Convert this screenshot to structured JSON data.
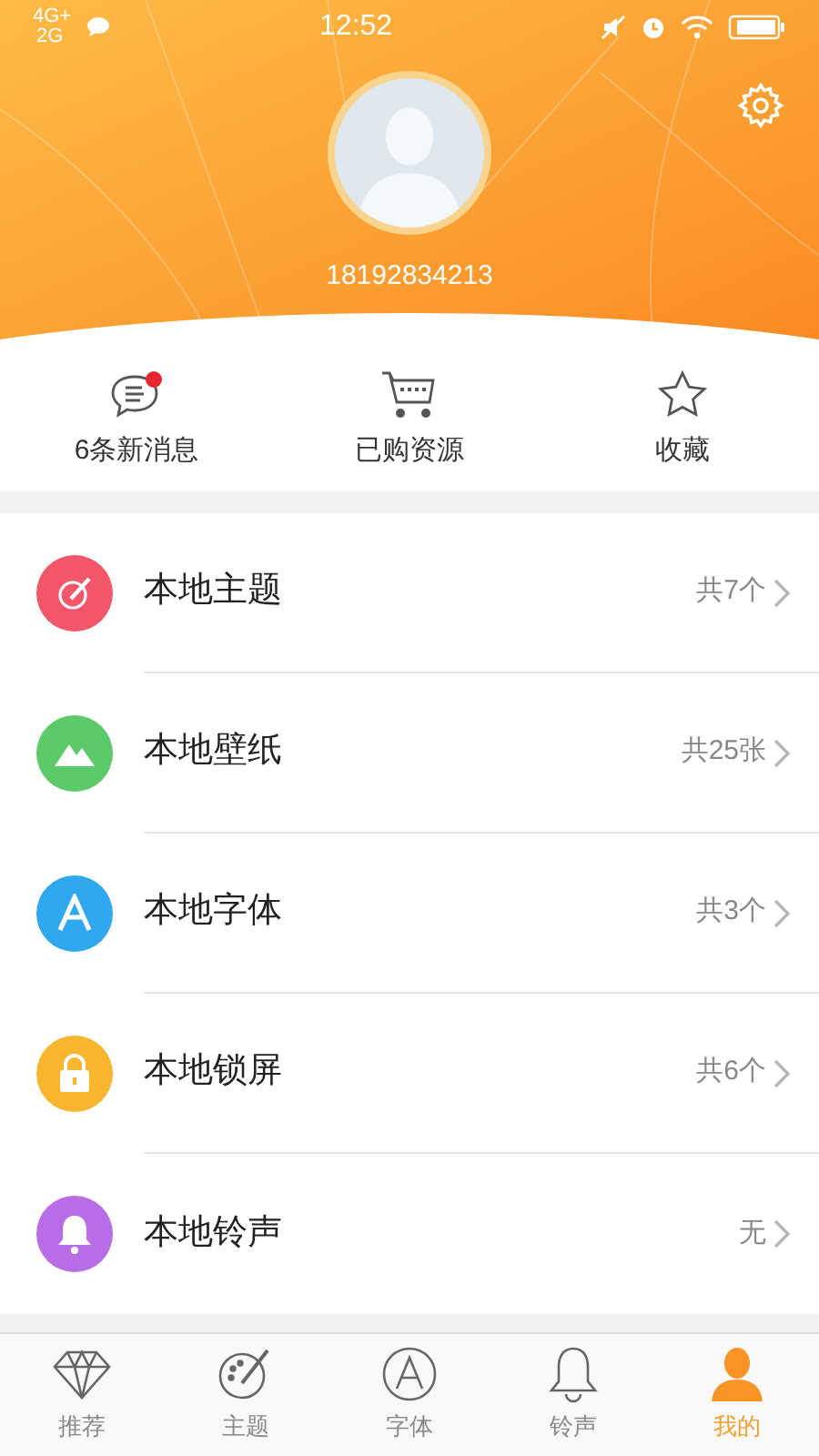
{
  "status_bar": {
    "network_1": "4G+",
    "network_2": "2G",
    "time": "12:52"
  },
  "profile": {
    "phone": "18192834213"
  },
  "quick_actions": [
    {
      "kind": "message",
      "label": "6条新消息",
      "badge": true
    },
    {
      "kind": "cart",
      "label": "已购资源",
      "badge": false
    },
    {
      "kind": "star",
      "label": "收藏",
      "badge": false
    }
  ],
  "list": [
    {
      "kind": "theme",
      "color": "#f2566a",
      "label": "本地主题",
      "count": "共7个"
    },
    {
      "kind": "wallpaper",
      "color": "#5cc96a",
      "label": "本地壁纸",
      "count": "共25张"
    },
    {
      "kind": "font",
      "color": "#2fa8ef",
      "label": "本地字体",
      "count": "共3个"
    },
    {
      "kind": "lock",
      "color": "#f8b630",
      "label": "本地锁屏",
      "count": "共6个"
    },
    {
      "kind": "ringtone",
      "color": "#b86ce6",
      "label": "本地铃声",
      "count": "无"
    }
  ],
  "tabs": [
    {
      "kind": "diamond",
      "label": "推荐",
      "selected": false
    },
    {
      "kind": "palette",
      "label": "主题",
      "selected": false
    },
    {
      "kind": "font",
      "label": "字体",
      "selected": false
    },
    {
      "kind": "bell",
      "label": "铃声",
      "selected": false
    },
    {
      "kind": "person",
      "label": "我的",
      "selected": true
    }
  ]
}
